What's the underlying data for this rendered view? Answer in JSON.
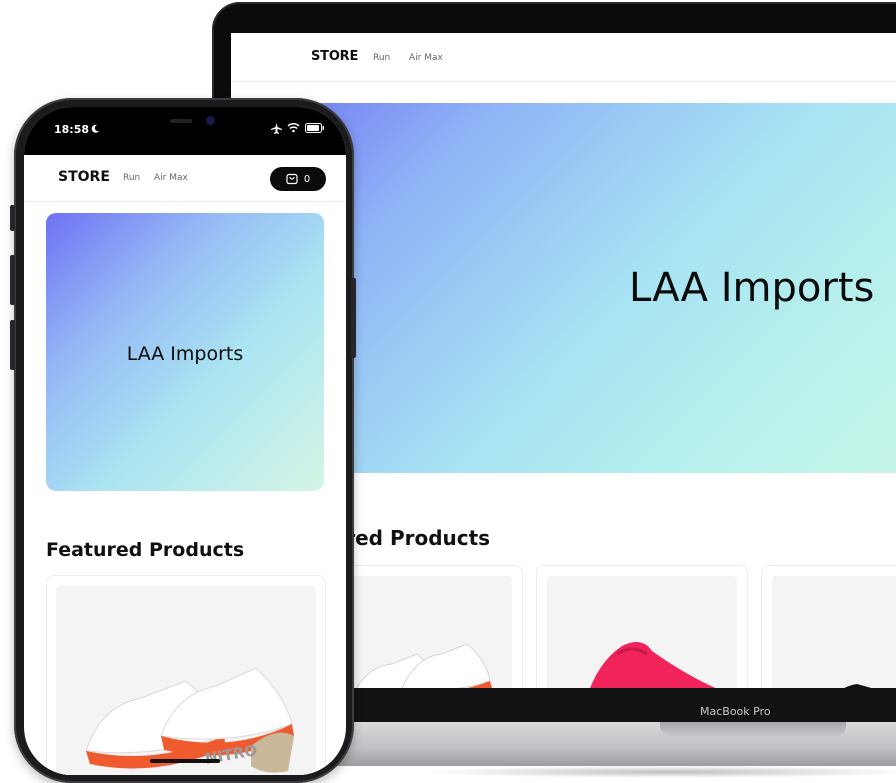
{
  "desktop": {
    "brand": "STORE",
    "nav_links": [
      "Run",
      "Air Max"
    ],
    "hero_title": "LAA Imports",
    "featured_title": "ured Products",
    "device_label": "MacBook Pro"
  },
  "mobile": {
    "status_time": "18:58",
    "brand": "STORE",
    "nav_links": [
      "Run",
      "Air Max"
    ],
    "cart_count": "0",
    "hero_title": "LAA Imports",
    "featured_title": "Featured Products",
    "product_text": "NITRO"
  },
  "colors": {
    "hero_start": "#6f72f4",
    "hero_end": "#c8f5e6",
    "cart_bg": "#0b0b0b",
    "shoe_accent": "#ef5b2e",
    "pink_shoe": "#f0245b"
  }
}
